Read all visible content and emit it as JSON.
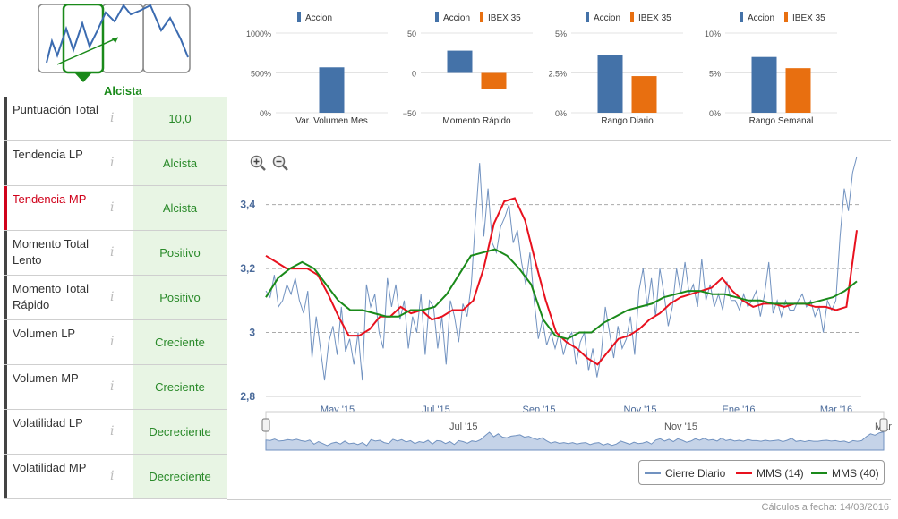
{
  "trend_widget": {
    "label": "Alcista",
    "colors": {
      "frame": "#888",
      "active": "#1a8a1a",
      "line": "#3b6bb0",
      "arrow": "#1a8a1a"
    }
  },
  "indicators": [
    {
      "label": "Puntuación Total",
      "value": "10,0",
      "highlight": false
    },
    {
      "label": "Tendencia LP",
      "value": "Alcista",
      "highlight": false
    },
    {
      "label": "Tendencia MP",
      "value": "Alcista",
      "highlight": true
    },
    {
      "label": "Momento Total Lento",
      "value": "Positivo",
      "highlight": false
    },
    {
      "label": "Momento Total Rápido",
      "value": "Positivo",
      "highlight": false
    },
    {
      "label": "Volumen LP",
      "value": "Creciente",
      "highlight": false
    },
    {
      "label": "Volumen MP",
      "value": "Creciente",
      "highlight": false
    },
    {
      "label": "Volatilidad LP",
      "value": "Decreciente",
      "highlight": false
    },
    {
      "label": "Volatilidad MP",
      "value": "Decreciente",
      "highlight": false
    }
  ],
  "info_glyph": "i",
  "colors": {
    "accion": "#4472a8",
    "ibex": "#e86f10",
    "price": "#7192c0",
    "mms14": "#e8111e",
    "mms40": "#1a8a1a"
  },
  "mini_charts": [
    {
      "title": "Var. Volumen Mes",
      "legend": [
        "Accion"
      ],
      "yticks": [
        "1000%",
        "500%",
        "0%"
      ],
      "ymin": 0,
      "ymax": 1000,
      "values": [
        570
      ]
    },
    {
      "title": "Momento Rápido",
      "legend": [
        "Accion",
        "IBEX 35"
      ],
      "yticks": [
        "50",
        "0",
        "−50"
      ],
      "ymin": -50,
      "ymax": 50,
      "values": [
        28,
        -20
      ]
    },
    {
      "title": "Rango Diario",
      "legend": [
        "Accion",
        "IBEX 35"
      ],
      "yticks": [
        "5%",
        "2.5%",
        "0%"
      ],
      "ymin": 0,
      "ymax": 5,
      "values": [
        3.6,
        2.3
      ]
    },
    {
      "title": "Rango Semanal",
      "legend": [
        "Accion",
        "IBEX 35"
      ],
      "yticks": [
        "10%",
        "5%",
        "0%"
      ],
      "ymin": 0,
      "ymax": 10,
      "values": [
        7.0,
        5.6
      ]
    }
  ],
  "chart_data": {
    "type": "line",
    "ylim": [
      2.8,
      3.55
    ],
    "yticks": [
      "3,4",
      "3,2",
      "3",
      "2,8"
    ],
    "ytick_values": [
      3.4,
      3.2,
      3.0,
      2.8
    ],
    "xticks": [
      "May '15",
      "Jul '15",
      "Sep '15",
      "Nov '15",
      "Ene '16",
      "Mar '16"
    ],
    "navigator_labels": [
      "Jul '15",
      "Nov '15",
      "Mar"
    ],
    "series": [
      {
        "name": "Cierre Diario",
        "values": [
          3.13,
          3.11,
          3.18,
          3.08,
          3.1,
          3.15,
          3.12,
          3.17,
          3.1,
          3.06,
          3.13,
          2.92,
          3.05,
          2.95,
          2.85,
          2.97,
          3.02,
          2.93,
          3.08,
          2.94,
          2.98,
          2.9,
          3.0,
          2.85,
          3.15,
          3.08,
          3.12,
          3.0,
          2.95,
          3.17,
          3.08,
          3.15,
          3.04,
          3.1,
          2.95,
          3.05,
          3.0,
          3.12,
          2.93,
          3.1,
          3.08,
          2.95,
          3.05,
          2.9,
          3.1,
          3.05,
          2.97,
          3.09,
          3.05,
          3.15,
          3.35,
          3.53,
          3.3,
          3.45,
          3.28,
          3.25,
          3.33,
          3.36,
          3.4,
          3.28,
          3.32,
          3.22,
          3.15,
          3.25,
          3.1,
          2.98,
          3.04,
          2.96,
          3.0,
          2.95,
          3.0,
          2.93,
          2.98,
          3.0,
          2.9,
          2.97,
          3.0,
          2.88,
          2.95,
          2.86,
          2.93,
          3.08,
          3.0,
          2.92,
          3.02,
          2.95,
          2.98,
          3.05,
          2.93,
          3.13,
          3.2,
          3.08,
          3.17,
          3.05,
          3.2,
          3.12,
          3.02,
          3.08,
          3.2,
          3.12,
          3.22,
          3.12,
          3.15,
          3.08,
          3.23,
          3.1,
          3.15,
          3.08,
          3.12,
          3.07,
          3.16,
          3.1,
          3.1,
          3.07,
          3.12,
          3.08,
          3.1,
          3.13,
          3.05,
          3.12,
          3.22,
          3.06,
          3.1,
          3.05,
          3.1,
          3.07,
          3.07,
          3.1,
          3.12,
          3.08,
          3.1,
          3.05,
          3.08,
          3.0,
          3.1,
          3.07,
          3.1,
          3.3,
          3.45,
          3.38,
          3.5,
          3.55
        ]
      },
      {
        "name": "MMS (14)",
        "values": [
          3.24,
          3.22,
          3.2,
          3.2,
          3.2,
          3.18,
          3.12,
          3.05,
          2.99,
          2.99,
          3.01,
          3.05,
          3.05,
          3.08,
          3.06,
          3.07,
          3.04,
          3.05,
          3.07,
          3.07,
          3.1,
          3.2,
          3.34,
          3.41,
          3.42,
          3.35,
          3.22,
          3.1,
          3.0,
          2.97,
          2.95,
          2.92,
          2.9,
          2.94,
          2.98,
          2.99,
          3.01,
          3.04,
          3.06,
          3.09,
          3.11,
          3.12,
          3.13,
          3.14,
          3.17,
          3.13,
          3.1,
          3.08,
          3.09,
          3.09,
          3.08,
          3.09,
          3.09,
          3.08,
          3.08,
          3.07,
          3.08,
          3.32
        ]
      },
      {
        "name": "MMS (40)",
        "values": [
          3.11,
          3.17,
          3.2,
          3.22,
          3.2,
          3.15,
          3.1,
          3.07,
          3.07,
          3.06,
          3.05,
          3.05,
          3.07,
          3.07,
          3.08,
          3.12,
          3.18,
          3.24,
          3.25,
          3.26,
          3.24,
          3.2,
          3.15,
          3.04,
          2.99,
          2.98,
          3.0,
          3.0,
          3.03,
          3.05,
          3.07,
          3.08,
          3.09,
          3.11,
          3.12,
          3.13,
          3.13,
          3.12,
          3.12,
          3.11,
          3.1,
          3.1,
          3.09,
          3.09,
          3.09,
          3.09,
          3.1,
          3.11,
          3.13,
          3.16
        ]
      }
    ]
  },
  "legend_items": [
    {
      "label": "Cierre Diario",
      "color": "#7192c0"
    },
    {
      "label": "MMS (14)",
      "color": "#e8111e"
    },
    {
      "label": "MMS (40)",
      "color": "#1a8a1a"
    }
  ],
  "footer": "Cálculos a fecha: 14/03/2016"
}
